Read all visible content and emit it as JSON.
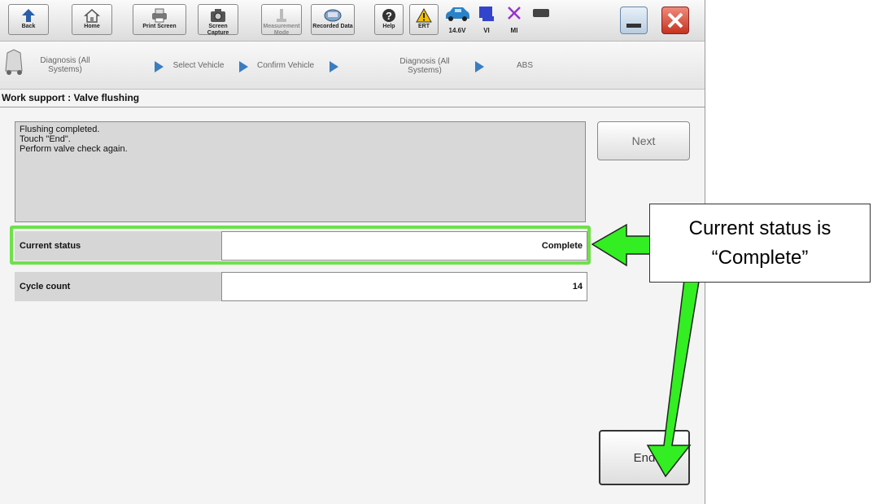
{
  "toolbar": {
    "buttons": [
      {
        "label": "Back",
        "icon": "back-arrow-icon"
      },
      {
        "label": "Home",
        "icon": "home-icon"
      },
      {
        "label": "Print Screen",
        "icon": "printer-icon"
      },
      {
        "label": "Screen Capture",
        "icon": "camera-icon"
      },
      {
        "label": "Measurement Mode",
        "icon": "measurement-icon"
      },
      {
        "label": "Recorded Data",
        "icon": "recorded-data-icon"
      },
      {
        "label": "Help",
        "icon": "help-icon"
      },
      {
        "label": "ERT",
        "icon": "warning-icon"
      }
    ],
    "status": [
      {
        "label": "14.6V",
        "icon": "vehicle-icon"
      },
      {
        "label": "VI",
        "icon": "vi-icon"
      },
      {
        "label": "MI",
        "icon": "mi-icon"
      }
    ]
  },
  "breadcrumb": [
    "Diagnosis (All Systems)",
    "Select Vehicle",
    "Confirm Vehicle",
    "Diagnosis (All Systems)",
    "ABS"
  ],
  "page": {
    "title": "Work support : Valve flushing",
    "message_lines": [
      "Flushing completed.",
      "Touch \"End\".",
      "Perform valve check again."
    ],
    "next_label": "Next",
    "end_label": "End",
    "rows": [
      {
        "label": "Current status",
        "value": "Complete"
      },
      {
        "label": "Cycle count",
        "value": "14"
      }
    ]
  },
  "annotation": {
    "callout_line1": "Current status is",
    "callout_line2": "“Complete”",
    "highlight_color": "#6ee04a",
    "arrow_color": "#33ee22"
  }
}
